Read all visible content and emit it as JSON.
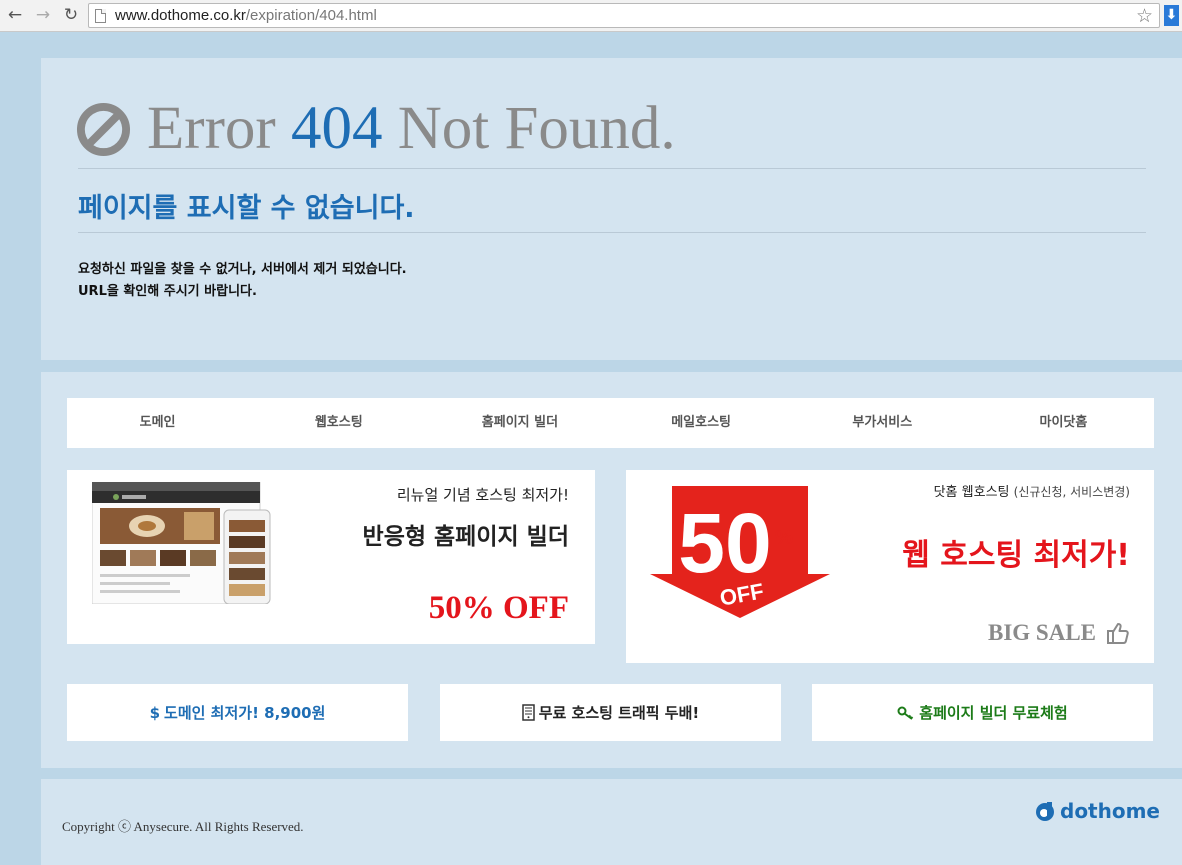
{
  "browser": {
    "url_host": "www.dothome.co.kr",
    "url_path": "/expiration/404.html",
    "back_icon": "←",
    "forward_icon": "→",
    "reload_icon": "↻",
    "star_icon": "☆",
    "download_icon": "⬇"
  },
  "error": {
    "word_error": "Error",
    "code": "404",
    "word_not_found": "Not Found.",
    "subtitle": "페이지를 표시할 수 없습니다.",
    "message_line1": "요청하신 파일을 찾을 수 없거나, 서버에서 제거 되었습니다.",
    "message_line2": "URL을 확인해 주시기 바랍니다."
  },
  "nav": {
    "items": [
      {
        "label": "도메인"
      },
      {
        "label": "웹호스팅"
      },
      {
        "label": "홈페이지 빌더"
      },
      {
        "label": "메일호스팅"
      },
      {
        "label": "부가서비스"
      },
      {
        "label": "마이닷홈"
      }
    ]
  },
  "banner_left": {
    "tagline": "리뉴얼 기념 호스팅 최저가!",
    "title": "반응형 홈페이지 빌더",
    "discount": "50% OFF"
  },
  "banner_right": {
    "tagline": "닷홈 웹호스팅",
    "tagline_note": "(신규신청, 서비스변경)",
    "title": "웹 호스팅 최저가!",
    "big_sale": "BIG SALE",
    "badge_number": "50",
    "badge_percent": "%",
    "badge_off": "OFF"
  },
  "quick_links": {
    "domain": {
      "icon": "$",
      "label": "도메인 최저가! 8,900원"
    },
    "hosting": {
      "icon": "server-icon",
      "label": "무료 호스팅 트래픽 두배!"
    },
    "builder": {
      "icon": "key-icon",
      "label": "홈페이지 빌더 무료체험"
    }
  },
  "footer": {
    "copyright": "Copyright ⓒ Anysecure. All Rights Reserved.",
    "logo_text": "dothome"
  },
  "colors": {
    "accent_blue": "#1e6db4",
    "sale_red": "#e4151c",
    "green": "#1c7b18",
    "panel_bg": "#d4e4f0",
    "page_bg": "#bcd6e7"
  }
}
